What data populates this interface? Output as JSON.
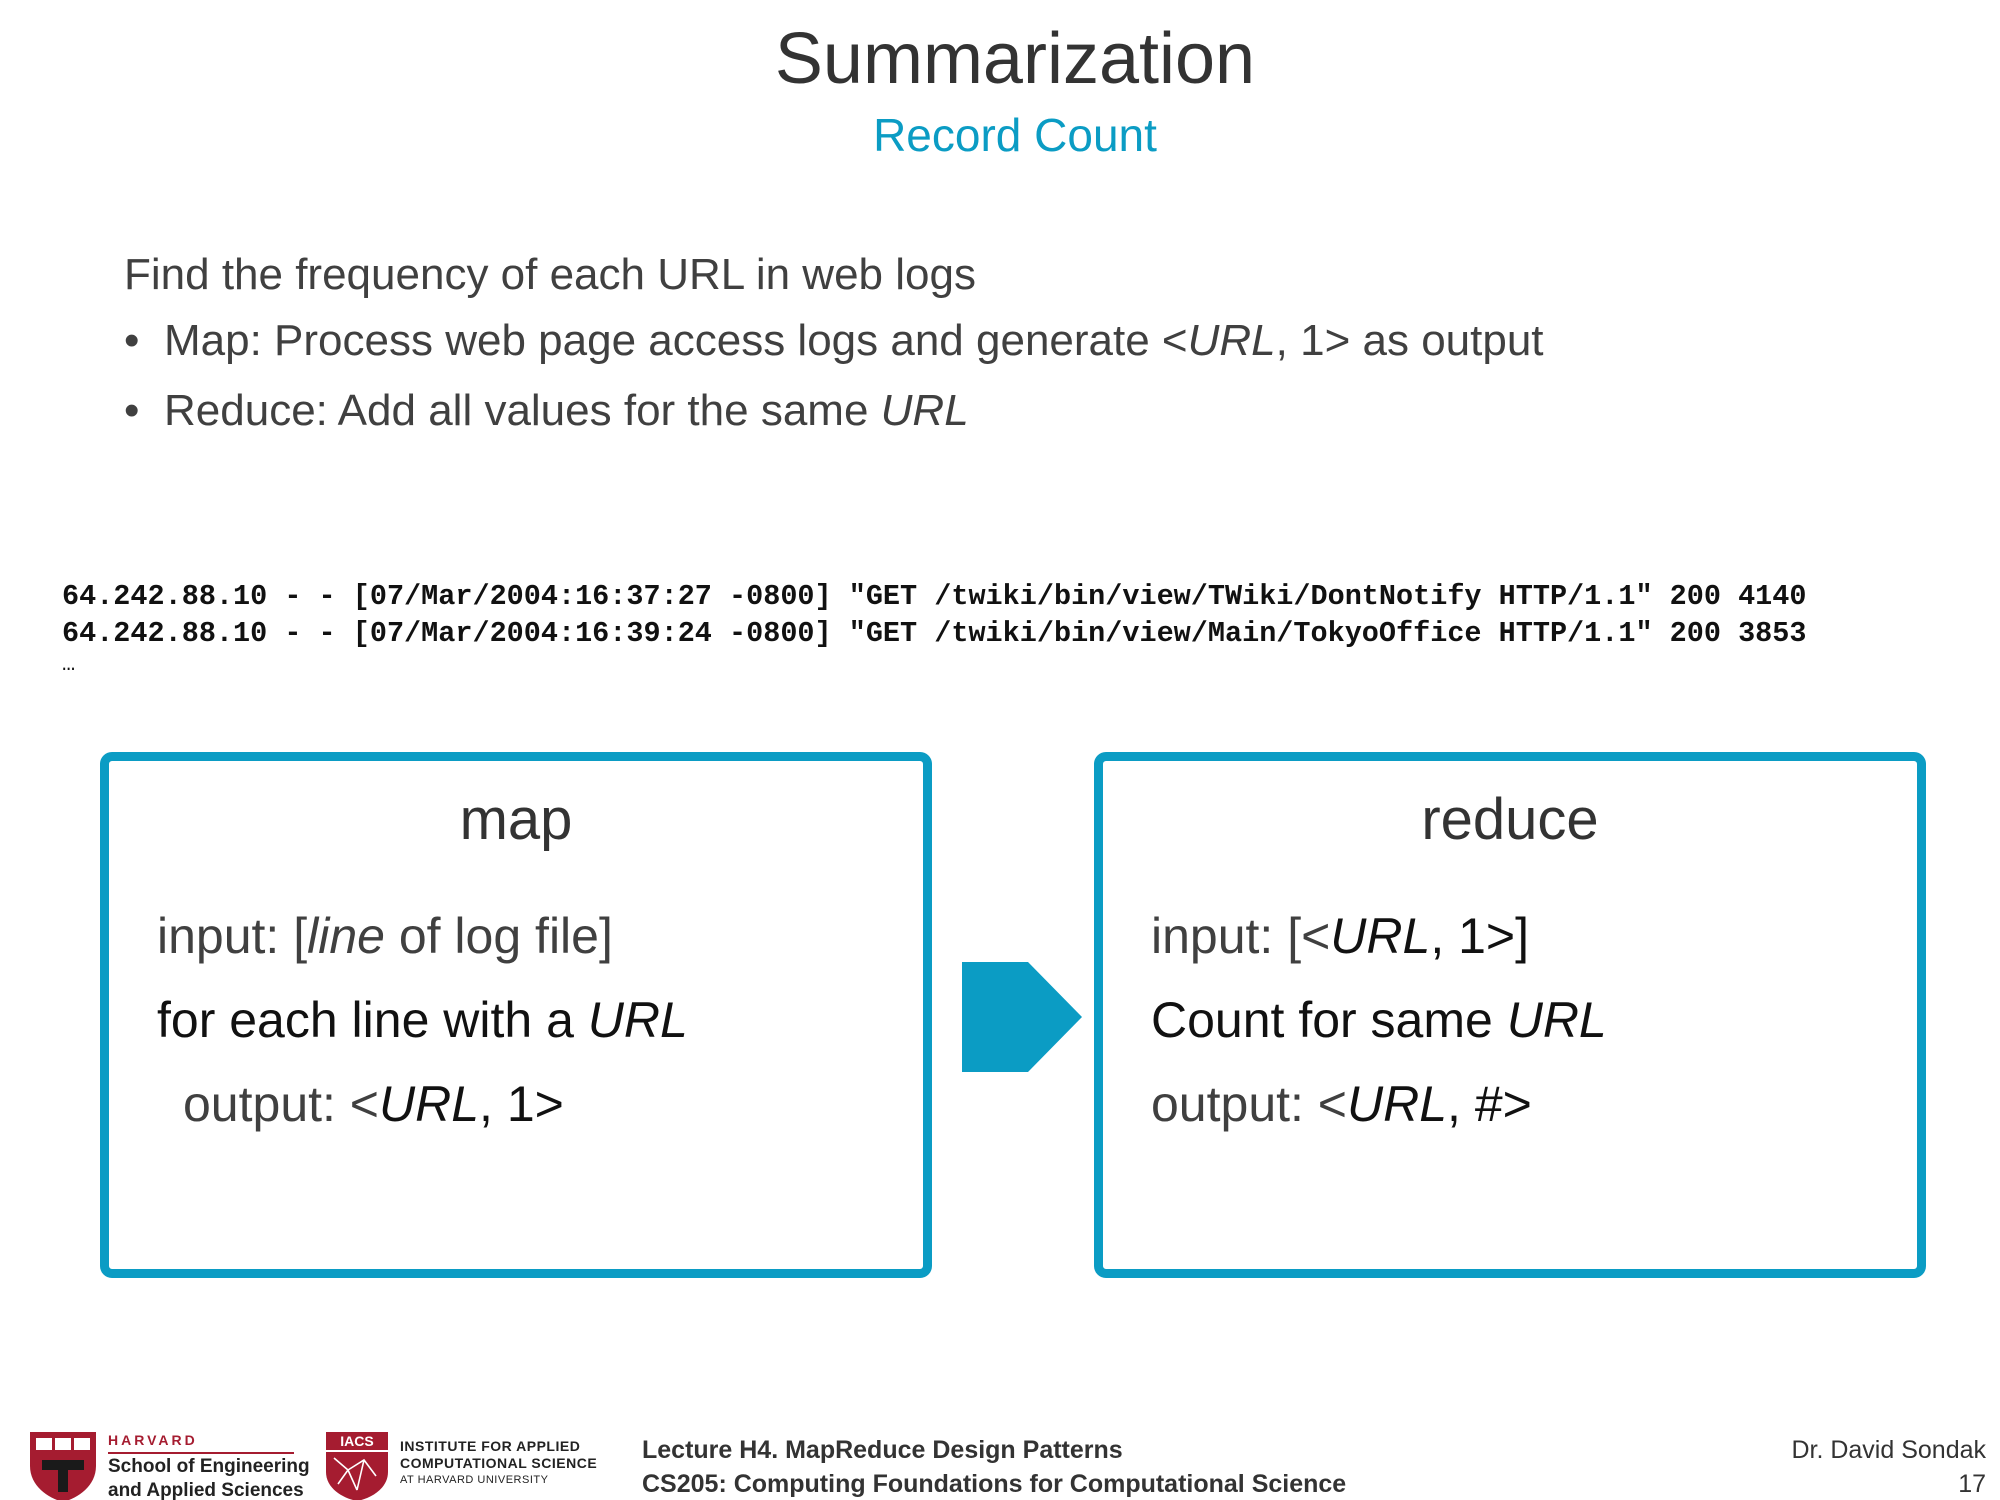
{
  "slide": {
    "title": "Summarization",
    "subtitle": "Record Count"
  },
  "intro": "Find the frequency of each URL in web logs",
  "bullets": [
    {
      "marker": "•",
      "text_before": "Map: Process web page access logs and generate <",
      "italic": "URL",
      "text_after": ", 1> as output"
    },
    {
      "marker": "•",
      "text_before": "Reduce: Add all values for the same ",
      "italic": "URL",
      "text_after": ""
    }
  ],
  "log_lines": [
    "64.242.88.10 - - [07/Mar/2004:16:37:27 -0800] \"GET /twiki/bin/view/TWiki/DontNotify HTTP/1.1\" 200 4140",
    "64.242.88.10 - - [07/Mar/2004:16:39:24 -0800] \"GET /twiki/bin/view/Main/TokyoOffice HTTP/1.1\" 200 3853"
  ],
  "log_ellipsis": "…",
  "map_box": {
    "heading": "map",
    "input_prefix": "input: [",
    "input_italic": "line",
    "input_suffix": " of log file]",
    "loop_prefix": "for each line with a ",
    "loop_italic": "URL",
    "output_prefix": "output: <",
    "output_italic": "URL",
    "output_suffix": ", 1>"
  },
  "reduce_box": {
    "heading": "reduce",
    "input_prefix": "input: [<",
    "input_italic": "URL",
    "input_suffix": ", 1>]",
    "count_prefix": "Count for same ",
    "count_italic": "URL",
    "output_prefix": "output: <",
    "output_italic": "URL",
    "output_suffix": ", #>"
  },
  "footer": {
    "lecture": "Lecture H4. MapReduce Design Patterns",
    "course": "CS205: Computing Foundations for Computational Science",
    "author": "Dr. David Sondak",
    "page_number": "17",
    "harvard_word": "HARVARD",
    "harvard_school_1": "School of Engineering",
    "harvard_school_2": "and Applied Sciences",
    "iacs_badge": "IACS",
    "iacs_line_1": "INSTITUTE FOR APPLIED",
    "iacs_line_2": "COMPUTATIONAL SCIENCE",
    "iacs_line_3": "AT HARVARD UNIVERSITY"
  },
  "colors": {
    "accent": "#0B9CC4",
    "text": "#404040",
    "harvard_red": "#A51C30"
  },
  "icons": {
    "arrow": "chevron-arrow-right-icon",
    "harvard_logo": "harvard-shield-icon",
    "iacs_logo": "iacs-shield-icon"
  }
}
